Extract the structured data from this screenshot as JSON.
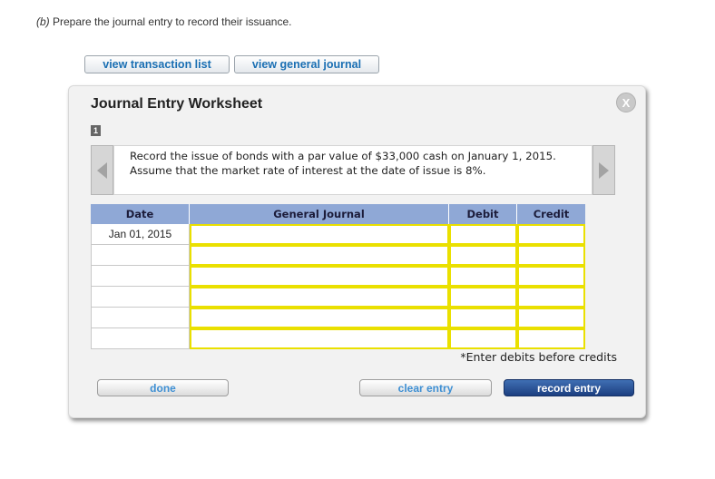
{
  "instruction": {
    "part_label": "(b)",
    "text": " Prepare the journal entry to record their issuance."
  },
  "top_buttons": {
    "transaction_list": "view transaction list",
    "general_journal": "view general journal"
  },
  "worksheet": {
    "title": "Journal Entry Worksheet",
    "close_label": "X",
    "entry_number": "1",
    "description": "Record the issue of bonds with a par value of $33,000 cash on January 1, 2015. Assume that the market rate of interest at the date of issue is 8%.",
    "columns": {
      "date": "Date",
      "general_journal": "General Journal",
      "debit": "Debit",
      "credit": "Credit"
    },
    "rows": [
      {
        "date": "Jan 01, 2015"
      },
      {
        "date": ""
      },
      {
        "date": ""
      },
      {
        "date": ""
      },
      {
        "date": ""
      },
      {
        "date": ""
      }
    ],
    "note": "*Enter debits before credits",
    "buttons": {
      "done": "done",
      "clear": "clear entry",
      "record": "record entry"
    }
  },
  "colors": {
    "header_bg": "#8fa8d6",
    "input_border": "#eae000",
    "link_blue": "#1a6fb3",
    "record_button": "#1c3f80"
  }
}
